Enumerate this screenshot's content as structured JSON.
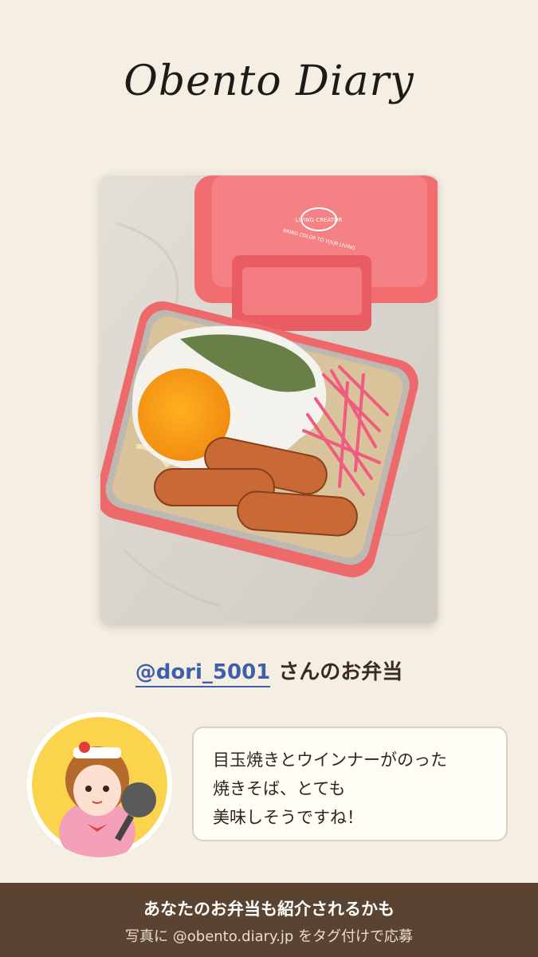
{
  "header": {
    "title": "Obento Diary"
  },
  "post": {
    "handle": "@dori_5001",
    "suffix": "さんのお弁当",
    "lid_brand": "LIVING CREATOR",
    "lid_tagline": "BRING COLOR TO YOUR LIVING"
  },
  "comment": {
    "lines": [
      "目玉焼きとウインナーがのった",
      "焼きそば、とても",
      "美味しそうですね！"
    ]
  },
  "footer": {
    "line1": "あなたのお弁当も紹介されるかも",
    "line2": "写真に @obento.diary.jp をタグ付けで応募"
  },
  "colors": {
    "background": "#f5efe3",
    "footer": "#5a4330",
    "handle": "#3f5fa8",
    "container": "#ee6a6a"
  }
}
